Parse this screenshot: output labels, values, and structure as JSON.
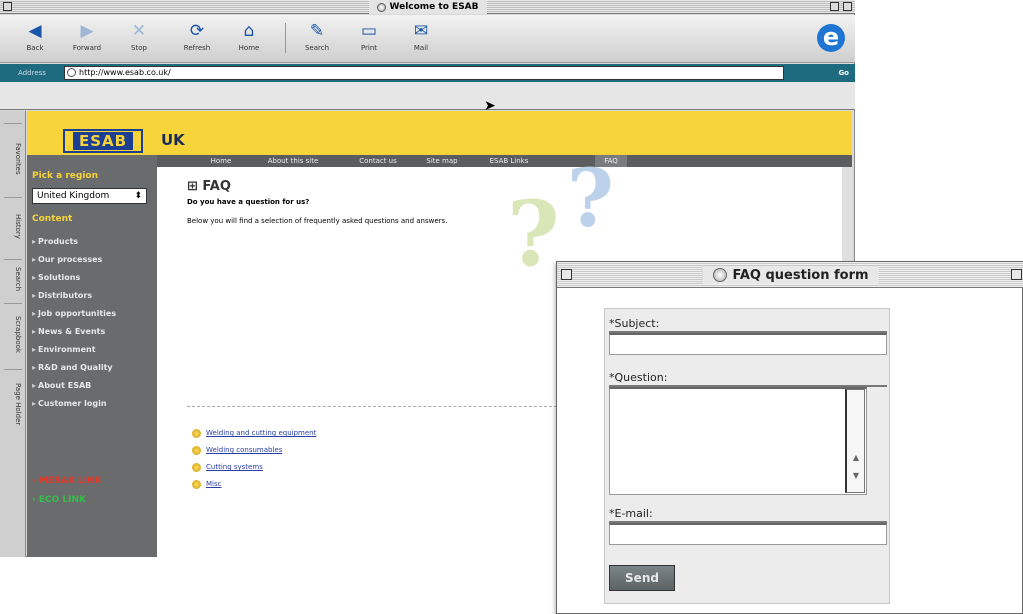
{
  "browser": {
    "title": "Welcome to ESAB",
    "toolbar": [
      {
        "icon": "back-arrow-icon",
        "label": "Back"
      },
      {
        "icon": "forward-arrow-icon",
        "label": "Forward"
      },
      {
        "icon": "stop-icon",
        "label": "Stop"
      },
      {
        "icon": "refresh-icon",
        "label": "Refresh"
      },
      {
        "icon": "home-icon",
        "label": "Home"
      },
      {
        "icon": "search-icon",
        "label": "Search"
      },
      {
        "icon": "print-icon",
        "label": "Print"
      },
      {
        "icon": "mail-icon",
        "label": "Mail"
      }
    ],
    "address_label": "Address",
    "address_value": "http://www.esab.co.uk/",
    "go_label": "Go"
  },
  "side_tabs": [
    "Favorites",
    "History",
    "Search",
    "Scrapbook",
    "Page Holder"
  ],
  "site": {
    "logo_text": "ESAB",
    "region_code": "UK",
    "nav": [
      "Home",
      "About this site",
      "Contact us",
      "Site map",
      "ESAB Links",
      "FAQ"
    ],
    "pick_region": "Pick a region",
    "region_selected": "United Kingdom",
    "content_header": "Content",
    "menu": [
      "Products",
      "Our processes",
      "Solutions",
      "Distributors",
      "Job opportunities",
      "News & Events",
      "Environment",
      "R&D and Quality",
      "About ESAB",
      "Customer login"
    ],
    "link_red": "› MERAX LINK",
    "link_green": "› ECO LINK",
    "faq_title": "⊞ FAQ",
    "faq_subtitle": "Do you have a question for us?",
    "faq_intro": "Below you will find a selection of frequently asked questions and answers.",
    "faq_links": [
      "Welding and cutting equipment",
      "Welding consumables",
      "Cutting systems",
      "Misc"
    ]
  },
  "form": {
    "title": "FAQ question form",
    "subject_label": "*Subject:",
    "subject_value": "",
    "question_label": "*Question:",
    "question_value": "",
    "email_label": "*E-mail:",
    "email_value": "",
    "send_label": "Send"
  }
}
